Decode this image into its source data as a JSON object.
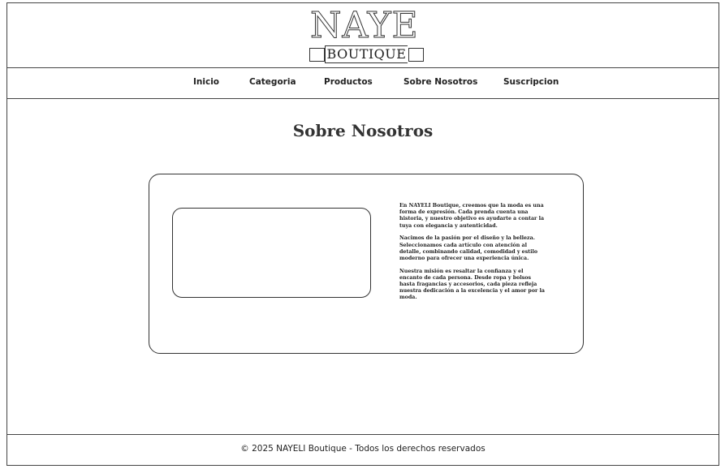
{
  "brand": {
    "logo_main": "NAYE",
    "logo_sub": "BOUTIQUE"
  },
  "nav": {
    "items": [
      {
        "label": "Inicio"
      },
      {
        "label": "Categoria"
      },
      {
        "label": "Productos"
      },
      {
        "label": "Sobre Nosotros"
      },
      {
        "label": "Suscripcion"
      }
    ]
  },
  "main": {
    "title": "Sobre Nosotros",
    "paragraphs": [
      "En NAYELI Boutique, creemos que la moda es una forma de expresión. Cada prenda cuenta una historia, y nuestro objetivo es ayudarte a contar la tuya con elegancia y autenticidad.",
      "Nacimos de la pasión por el diseño y la belleza. Seleccionamos cada artículo con atención al detalle, combinando calidad, comodidad y estilo moderno para ofrecer una experiencia única.",
      "Nuestra misión es resaltar la confianza y el encanto de cada persona. Desde ropa y bolsos hasta fragancias y accesorios, cada pieza refleja nuestra dedicación a la excelencia y el amor por la moda."
    ]
  },
  "footer": {
    "text": "© 2025 NAYELI Boutique - Todos los derechos reservados"
  }
}
